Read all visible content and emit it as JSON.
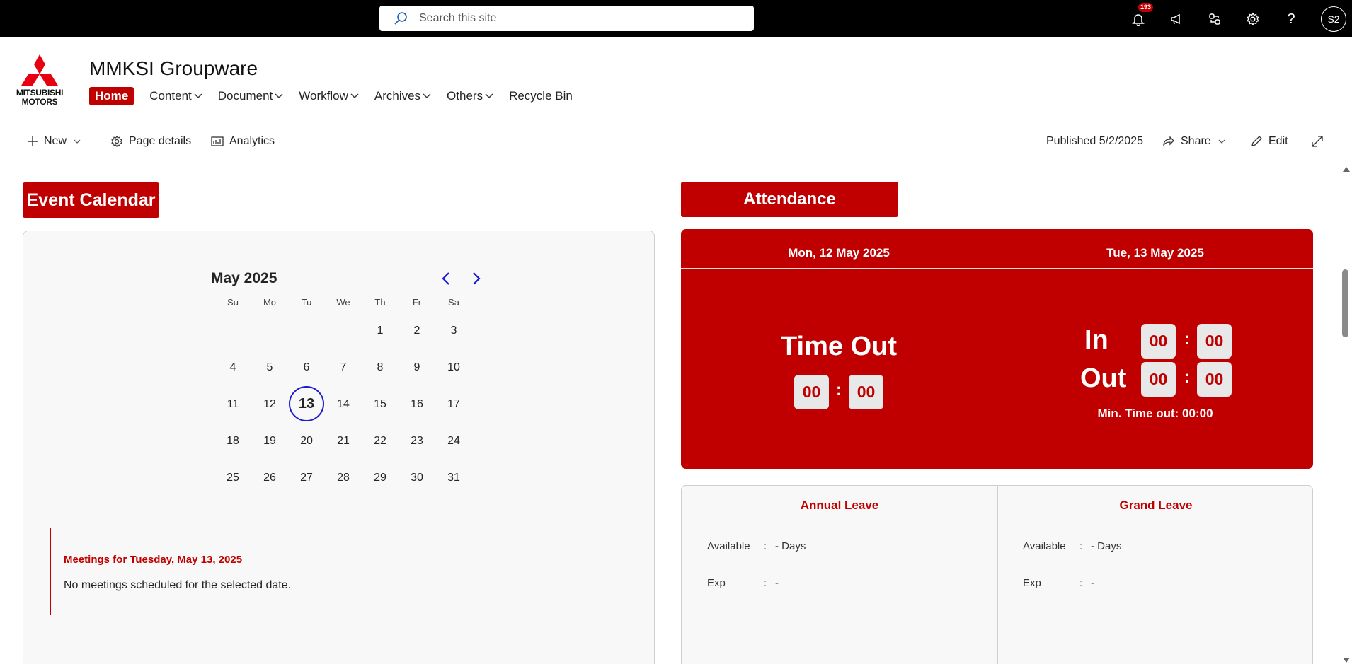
{
  "topbar": {
    "search_placeholder": "Search this site",
    "notification_count": "193",
    "avatar_initials": "S2"
  },
  "site": {
    "title": "MMKSI Groupware",
    "logo_text_line1": "MITSUBISHI",
    "logo_text_line2": "MOTORS",
    "nav": {
      "home": "Home",
      "content": "Content",
      "document": "Document",
      "workflow": "Workflow",
      "archives": "Archives",
      "others": "Others",
      "recycle_bin": "Recycle Bin"
    }
  },
  "commandbar": {
    "new": "New",
    "page_details": "Page details",
    "analytics": "Analytics",
    "published": "Published 5/2/2025",
    "share": "Share",
    "edit": "Edit"
  },
  "event_calendar": {
    "title": "Event Calendar",
    "month": "May 2025",
    "weekdays": [
      "Su",
      "Mo",
      "Tu",
      "We",
      "Th",
      "Fr",
      "Sa"
    ],
    "weeks": [
      [
        "",
        "",
        "",
        "",
        "1",
        "2",
        "3"
      ],
      [
        "4",
        "5",
        "6",
        "7",
        "8",
        "9",
        "10"
      ],
      [
        "11",
        "12",
        "13",
        "14",
        "15",
        "16",
        "17"
      ],
      [
        "18",
        "19",
        "20",
        "21",
        "22",
        "23",
        "24"
      ],
      [
        "25",
        "26",
        "27",
        "28",
        "29",
        "30",
        "31"
      ]
    ],
    "selected_day": "13",
    "meetings_title": "Meetings for Tuesday, May 13, 2025",
    "meetings_text": "No meetings scheduled for the selected date."
  },
  "attendance": {
    "title": "Attendance",
    "day1": {
      "header": "Mon, 12 May 2025",
      "label": "Time Out",
      "hh": "00",
      "mm": "00"
    },
    "day2": {
      "header": "Tue, 13 May 2025",
      "in_label": "In",
      "out_label": "Out",
      "in_hh": "00",
      "in_mm": "00",
      "out_hh": "00",
      "out_mm": "00",
      "min_time_out": "Min. Time out: 00:00"
    },
    "colon": ":"
  },
  "leave": {
    "annual": {
      "title": "Annual Leave",
      "available_label": "Available",
      "available_value": "- Days",
      "exp_label": "Exp",
      "exp_value": "-"
    },
    "grand": {
      "title": "Grand Leave",
      "available_label": "Available",
      "available_value": "- Days",
      "exp_label": "Exp",
      "exp_value": "-"
    },
    "sep": ":"
  },
  "colors": {
    "brand_red": "#c00000",
    "today_ring": "#1a1ad0",
    "nav_arrow": "#1a1ad0"
  }
}
